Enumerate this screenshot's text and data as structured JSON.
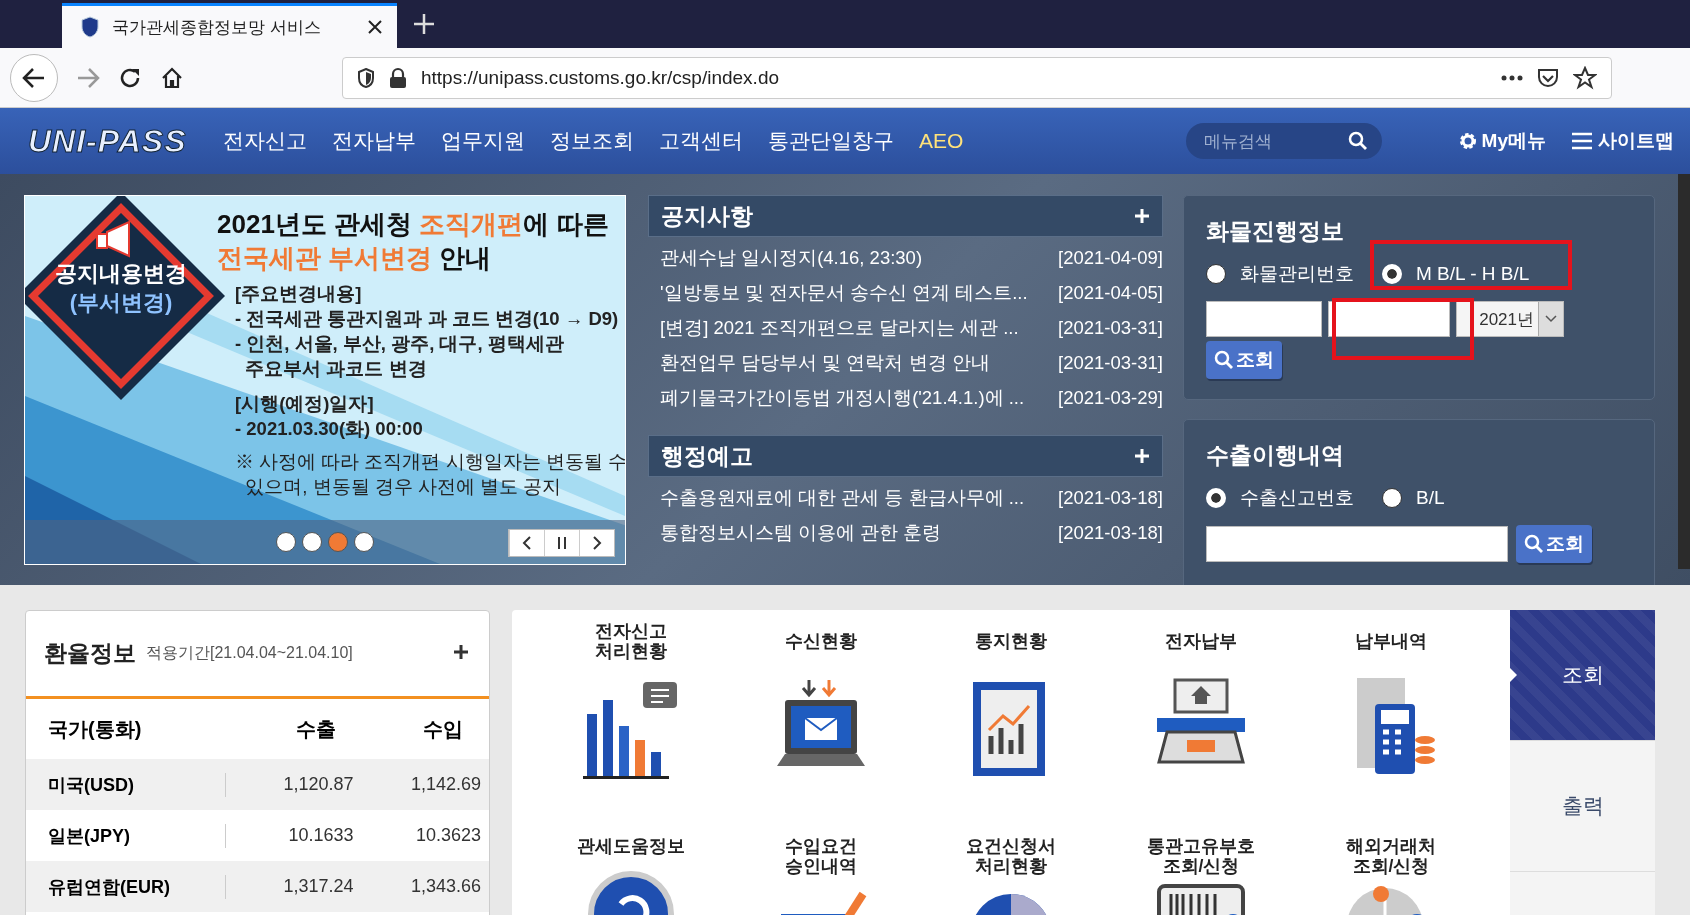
{
  "browser": {
    "tab_title": "국가관세종합정보망 서비스",
    "url": "https://unipass.customs.go.kr/csp/index.do"
  },
  "nav": {
    "logo": "UNI-PASS",
    "items": [
      {
        "label": "전자신고",
        "highlight": false
      },
      {
        "label": "전자납부",
        "highlight": false
      },
      {
        "label": "업무지원",
        "highlight": false
      },
      {
        "label": "정보조회",
        "highlight": false
      },
      {
        "label": "고객센터",
        "highlight": false
      },
      {
        "label": "통관단일창구",
        "highlight": false
      },
      {
        "label": "AEO",
        "highlight": true
      }
    ],
    "search": {
      "placeholder": "메뉴검색"
    },
    "my_menu": "My메뉴",
    "sitemap": "사이트맵"
  },
  "banner": {
    "sign": [
      "공지내용변경",
      "(부서변경)"
    ],
    "headline": [
      [
        {
          "text": "2021년도 관세청 ",
          "accent": false
        },
        {
          "text": "조직개편",
          "accent": true
        },
        {
          "text": "에 따른",
          "accent": false
        }
      ],
      [
        {
          "text": "전국세관 부서변경",
          "accent": true
        },
        {
          "text": " 안내",
          "accent": false
        }
      ]
    ],
    "body": [
      "[주요변경내용]",
      "- 전국세관 통관지원과 과 코드 변경(10 → D9)",
      "- 인천, 서울, 부산, 광주, 대구, 평택세관",
      "  주요부서 과코드 변경",
      "[시행(예정)일자]",
      "- 2021.03.30(화) 00:00",
      "※ 사정에 따라 조직개편 시행일자는 변동될 수",
      "  있으며, 변동될 경우 사전에 별도 공지"
    ],
    "dots": [
      {
        "selected": false
      },
      {
        "selected": false
      },
      {
        "selected": true
      },
      {
        "selected": false
      }
    ]
  },
  "notices": {
    "title": "공지사항",
    "items": [
      {
        "title": "관세수납 일시정지(4.16, 23:30)",
        "date": "[2021-04-09]"
      },
      {
        "title": "'일방통보 및 전자문서 송수신 연계 테스트...",
        "date": "[2021-04-05]"
      },
      {
        "title": "[변경] 2021 조직개편으로 달라지는 세관 ...",
        "date": "[2021-03-31]"
      },
      {
        "title": "환전업무 담당부서 및 연락처 변경 안내",
        "date": "[2021-03-31]"
      },
      {
        "title": "폐기물국가간이동법 개정시행('21.4.1.)에 ...",
        "date": "[2021-03-29]"
      }
    ]
  },
  "admin_notices": {
    "title": "행정예고",
    "items": [
      {
        "title": "수출용원재료에 대한 관세 등 환급사무에 ...",
        "date": "[2021-03-18]"
      },
      {
        "title": "통합정보시스템 이용에 관한 훈령",
        "date": "[2021-03-18]"
      }
    ]
  },
  "cargo": {
    "title": "화물진행정보",
    "options": [
      {
        "label": "화물관리번호",
        "selected": false
      },
      {
        "label": "M B/L - H B/L",
        "selected": true
      }
    ],
    "year": "2021년",
    "button": "조회"
  },
  "export": {
    "title": "수출이행내역",
    "options": [
      {
        "label": "수출신고번호",
        "selected": true
      },
      {
        "label": "B/L",
        "selected": false
      }
    ],
    "button": "조회"
  },
  "exchange": {
    "title": "환율정보",
    "period": "적용기간[21.04.04~21.04.10]",
    "columns": [
      "국가(통화)",
      "수출",
      "수입"
    ],
    "rows": [
      [
        "미국(USD)",
        "1,120.87",
        "1,142.69"
      ],
      [
        "일본(JPY)",
        "10.1633",
        "10.3623"
      ],
      [
        "유럽연합(EUR)",
        "1,317.24",
        "1,343.66"
      ]
    ]
  },
  "services": [
    "전자신고\n처리현황",
    "수신현황",
    "통지현황",
    "전자납부",
    "납부내역",
    "관세도움정보",
    "수입요건\n승인내역",
    "요건신청서\n처리현황",
    "통관고유부호\n조회/신청",
    "해외거래처\n조회/신청"
  ],
  "side_tabs": [
    {
      "label": "조회",
      "selected": true
    },
    {
      "label": "출력",
      "selected": false
    }
  ]
}
